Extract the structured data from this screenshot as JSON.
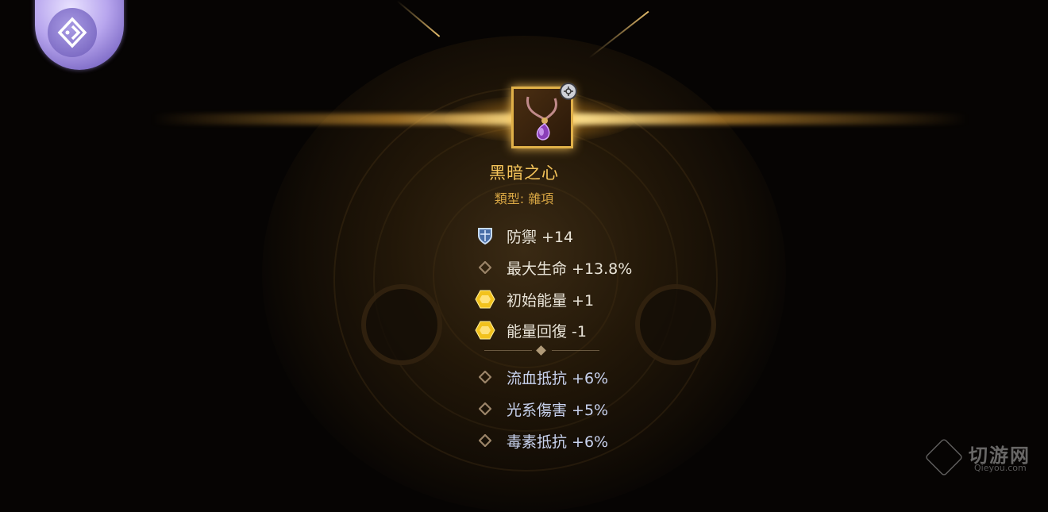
{
  "item": {
    "name": "黑暗之心",
    "type": "類型: 雜項",
    "icon": "amethyst-pendant-icon"
  },
  "stats_main": [
    {
      "label": "防禦 +14",
      "icon": "shield-icon"
    },
    {
      "label": "最大生命 +13.8%",
      "icon": "diamond-icon"
    },
    {
      "label": "初始能量 +1",
      "icon": "energy-hexagon-icon"
    },
    {
      "label": "能量回復 -1",
      "icon": "energy-hexagon-icon"
    }
  ],
  "stats_sub": [
    {
      "label": "流血抵抗 +6%",
      "icon": "diamond-icon"
    },
    {
      "label": "光系傷害 +5%",
      "icon": "diamond-icon"
    },
    {
      "label": "毒素抵抗 +6%",
      "icon": "diamond-icon"
    }
  ],
  "watermark": {
    "title": "切游网",
    "sub": "Qieyou.com"
  },
  "colors": {
    "item_name": "#f5c45a",
    "item_type": "#d9a744",
    "main_stat": "#e9e4d8",
    "sub_stat": "#c8d2ee",
    "frame": "#e0b048",
    "energy": "#f2c21d"
  }
}
